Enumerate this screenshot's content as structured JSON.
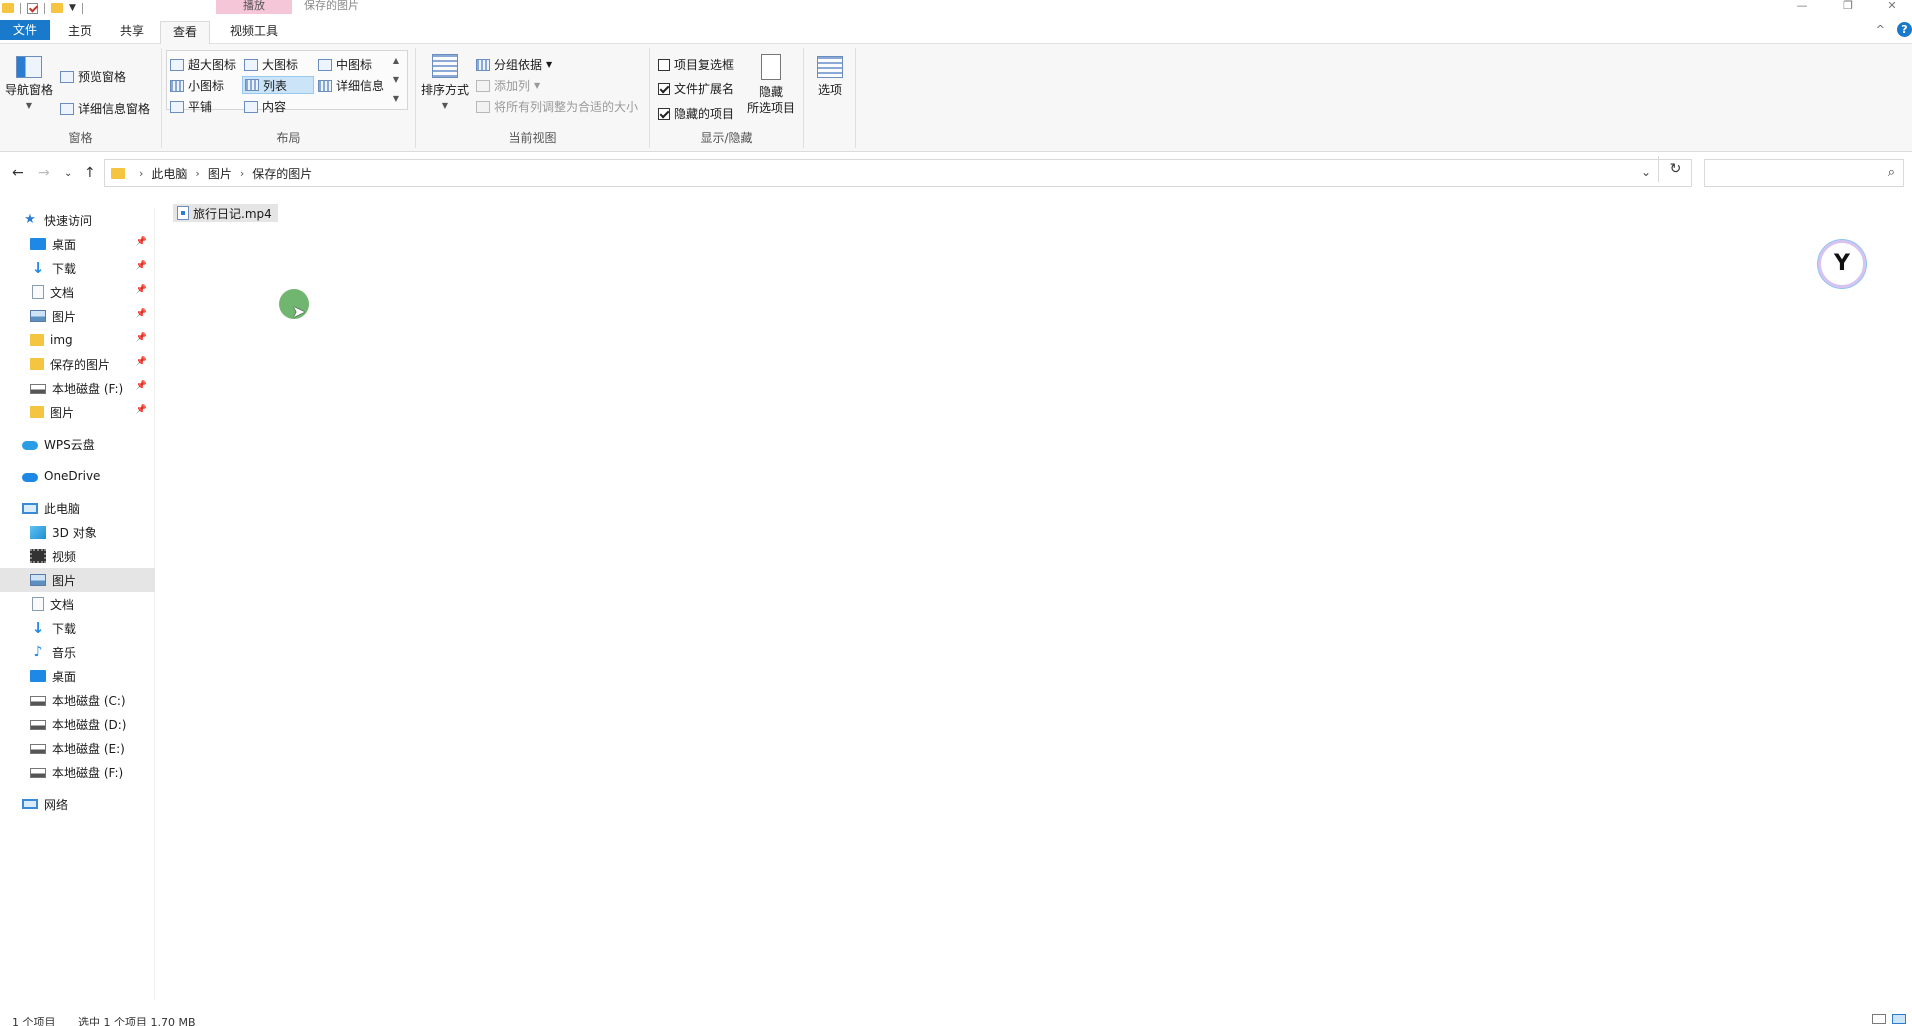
{
  "titlebar": {
    "context_tab": "播放",
    "window_title": "保存的图片",
    "minimize": "—",
    "restore": "❐",
    "close": "✕"
  },
  "tabs": [
    {
      "label": "文件"
    },
    {
      "label": "主页"
    },
    {
      "label": "共享"
    },
    {
      "label": "查看"
    },
    {
      "label": "视频工具"
    }
  ],
  "ribbon": {
    "panes": {
      "label": "窗格",
      "nav_pane": "导航窗格",
      "preview_pane": "预览窗格",
      "details_pane": "详细信息窗格"
    },
    "layout": {
      "label": "布局",
      "extra_large": "超大图标",
      "large": "大图标",
      "medium": "中图标",
      "small": "小图标",
      "list": "列表",
      "details": "详细信息",
      "tiles": "平铺",
      "content": "内容"
    },
    "current_view": {
      "label": "当前视图",
      "sort": "排序方式",
      "group_by": "分组依据",
      "add_column": "添加列",
      "fit_columns": "将所有列调整为合适的大小"
    },
    "show_hide": {
      "label": "显示/隐藏",
      "item_checkboxes": "项目复选框",
      "item_checkboxes_checked": false,
      "file_extensions": "文件扩展名",
      "file_extensions_checked": true,
      "hidden_items": "隐藏的项目",
      "hidden_items_checked": true,
      "hide_selected_line1": "隐藏",
      "hide_selected_line2": "所选项目"
    },
    "options": "选项"
  },
  "address": {
    "breadcrumb": [
      "此电脑",
      "图片",
      "保存的图片"
    ]
  },
  "sidebar": {
    "quick_access": "快速访问",
    "quick_items": [
      {
        "label": "桌面",
        "icon": "desktop-icon"
      },
      {
        "label": "下载",
        "icon": "download-icon"
      },
      {
        "label": "文档",
        "icon": "document-icon"
      },
      {
        "label": "图片",
        "icon": "pictures-icon"
      },
      {
        "label": "img",
        "icon": "folder-icon"
      },
      {
        "label": "保存的图片",
        "icon": "folder-icon"
      },
      {
        "label": "本地磁盘 (F:)",
        "icon": "drive-icon"
      },
      {
        "label": "图片",
        "icon": "folder-icon"
      }
    ],
    "wps": "WPS云盘",
    "onedrive": "OneDrive",
    "this_pc": "此电脑",
    "pc_items": [
      {
        "label": "3D 对象",
        "icon": "3d-objects-icon"
      },
      {
        "label": "视频",
        "icon": "video-icon"
      },
      {
        "label": "图片",
        "icon": "pictures-icon"
      },
      {
        "label": "文档",
        "icon": "document-icon"
      },
      {
        "label": "下载",
        "icon": "download-icon"
      },
      {
        "label": "音乐",
        "icon": "music-icon"
      },
      {
        "label": "桌面",
        "icon": "desktop-icon"
      },
      {
        "label": "本地磁盘 (C:)",
        "icon": "system-drive-icon"
      },
      {
        "label": "本地磁盘 (D:)",
        "icon": "drive-icon"
      },
      {
        "label": "本地磁盘 (E:)",
        "icon": "drive-icon"
      },
      {
        "label": "本地磁盘 (F:)",
        "icon": "drive-icon"
      }
    ],
    "network": "网络",
    "selected": "图片"
  },
  "content": {
    "files": [
      {
        "name": "旅行日记.mp4",
        "icon": "video-file-icon"
      }
    ]
  },
  "status": {
    "count": "1 个项目",
    "selection": "选中 1 个项目 1.70 MB"
  }
}
